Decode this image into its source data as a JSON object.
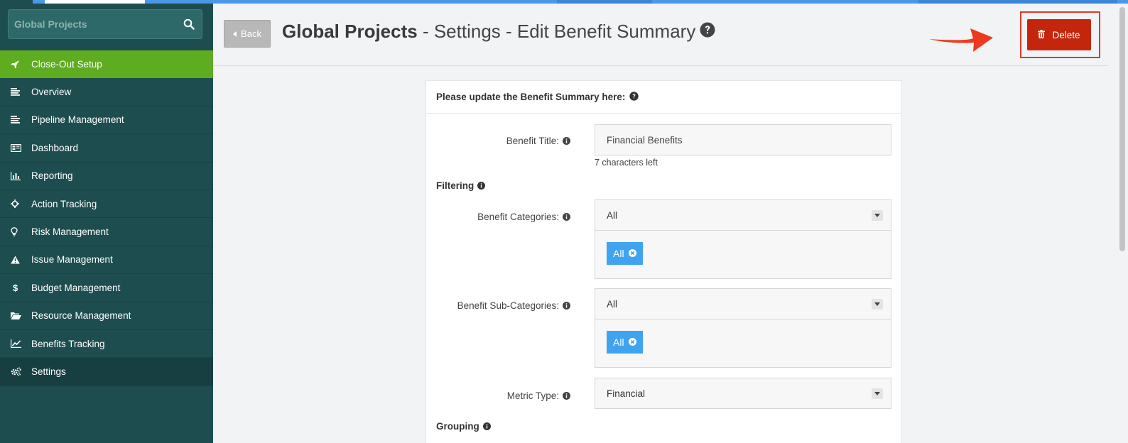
{
  "app": {
    "search_placeholder": "Global Projects"
  },
  "sidebar": {
    "items": [
      {
        "label": "Close-Out Setup",
        "icon": "rocket-icon"
      },
      {
        "label": "Overview",
        "icon": "lines-icon"
      },
      {
        "label": "Pipeline Management",
        "icon": "lines-icon"
      },
      {
        "label": "Dashboard",
        "icon": "dashboard-icon"
      },
      {
        "label": "Reporting",
        "icon": "bar-chart-icon"
      },
      {
        "label": "Action Tracking",
        "icon": "crosshair-icon"
      },
      {
        "label": "Risk Management",
        "icon": "lightbulb-icon"
      },
      {
        "label": "Issue Management",
        "icon": "warning-icon"
      },
      {
        "label": "Budget Management",
        "icon": "dollar-icon"
      },
      {
        "label": "Resource Management",
        "icon": "folder-open-icon"
      },
      {
        "label": "Benefits Tracking",
        "icon": "line-chart-icon"
      },
      {
        "label": "Settings",
        "icon": "gears-icon"
      }
    ]
  },
  "header": {
    "back_label": "Back",
    "title_bold": "Global Projects",
    "title_rest": " - Settings - Edit Benefit Summary",
    "delete_label": "Delete"
  },
  "form": {
    "heading": "Please update the Benefit Summary here:",
    "benefit_title_label": "Benefit Title:",
    "benefit_title_value": "Financial Benefits",
    "chars_left": "7 characters left",
    "filtering_label": "Filtering",
    "benefit_categories_label": "Benefit Categories:",
    "benefit_categories_value": "All",
    "benefit_categories_tag": "All",
    "benefit_subcategories_label": "Benefit Sub-Categories:",
    "benefit_subcategories_value": "All",
    "benefit_subcategories_tag": "All",
    "metric_type_label": "Metric Type:",
    "metric_type_value": "Financial",
    "grouping_label": "Grouping"
  },
  "colors": {
    "sidebar_bg": "#1e4d4f",
    "active_item": "#5eac1f",
    "delete_button": "#c4260d",
    "tag": "#3fa3f0",
    "annotation": "#e03a2a"
  }
}
